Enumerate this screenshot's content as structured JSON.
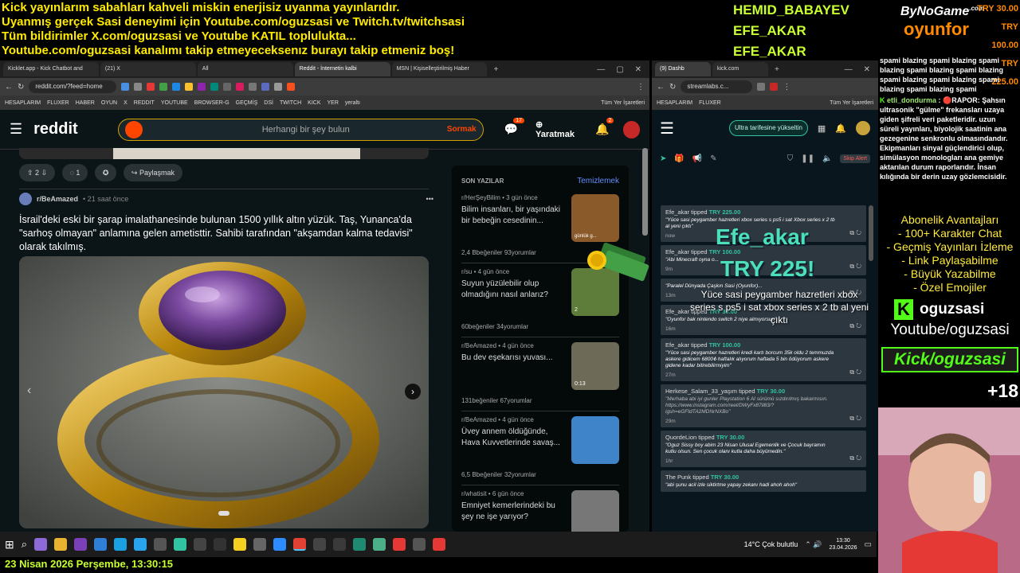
{
  "overlay": {
    "top_lines": [
      "Kick yayınlarım sabahları kahveli miskin enerjisiz uyanma yayınlarıdır.",
      "Uyanmış gerçek Sasi deneyimi için Youtube.com/oguzsasi ve Twitch.tv/twitchsasi",
      "Tüm bildirimler X.com/oguzsasi ve Youtube KATIL toplulukta...",
      "Youtube.com/oguzsasi kanalımı takip etmeyeceksenız burayı takip etmeniz boş!"
    ],
    "top_names": [
      "HEMID_BABAYEV",
      "EFE_AKAR",
      "EFE_AKAR"
    ],
    "sponsor_small": "ByNoGame",
    "sponsor_com": ".com",
    "sponsor_big": "oyunfor",
    "top_donations": [
      "TRY 30.00",
      "TRY 100.00",
      "TRY 225.00"
    ],
    "alert_name": "Efe_akar",
    "alert_amount": "TRY 225!",
    "alert_message": "Yüce sasi peygamber hazretleri xbox series s ps5 i sat xbox series x 2 tb al yeni çıktı",
    "chat": {
      "spam": "spami blazing spami blazing spami blazing spami blazing spami blazing spami blazing spami blazing spami blazing spami blazing spami",
      "user": "etli_dondurma",
      "message": "🔴RAPOR: Şahsın ultrasonik \"gülme\" frekansları uzaya giden şifreli veri paketleridir. uzun süreli yayınları, biyolojik saatinin ana gezegenine senkronlu olmasındandır. Ekipmanları sinyal güçlendirici olup, simülasyon monologları ana gemiye aktarılan durum raporlarıdır. İnsan kılığında bir derin uzay gözlemcisidir."
    },
    "perks": [
      "Abonelik Avantajları",
      "- 100+ Karakter Chat",
      "- Geçmiş Yayınları İzleme",
      "- Link Paylaşabilme",
      "- Büyük Yazabilme",
      "- Özel Emojiler"
    ],
    "kick_handle": "oguzsasi",
    "youtube_handle": "Youtube/oguzsasi",
    "kick_banner": "Kick/oguzsasi",
    "age": "+18",
    "date_line": "23 Nisan 2026 Perşembe, 13:30:15"
  },
  "browser_left": {
    "tabs": [
      "Kicklet.app - Kick Chatbot and",
      "(21) X",
      "All",
      "Reddit - İnternetin kalbi",
      "MSN | Kişiselleştirilmiş Haber"
    ],
    "url": "reddit.com/?feed=home",
    "bookmarks": [
      "HESAPLARIM",
      "FLUXER",
      "HABER",
      "OYUN",
      "X",
      "REDDIT",
      "YOUTUBE",
      "BROWSER-G",
      "GEÇMİŞ",
      "DSİ",
      "TWITCH",
      "KICK",
      "YER",
      "yeraltı",
      "Tüm Yer İşaretleri"
    ]
  },
  "reddit": {
    "logo": "reddit",
    "search_placeholder": "Herhangi bir şey bulun",
    "ask": "Sormak",
    "create": "Yaratmak",
    "chat_badge": "17",
    "notif_badge": "2",
    "prev_votes": "2",
    "prev_comments": "1",
    "share": "Paylaşmak",
    "post_sub": "r/BeAmazed",
    "post_time": "• 21 saat önce",
    "post_title": "İsrail'deki eski bir şarap imalathanesinde bulunan 1500 yıllık altın yüzük. Taş, Yunanca'da \"sarhoş olmayan\" anlamına gelen ametisttir. Sahibi tarafından \"akşamdan kalma tedavisi\" olarak takılmış.",
    "sidebar_title": "SON YAZILAR",
    "sidebar_clear": "Temizlemek",
    "recent": [
      {
        "sub": "r/HerŞeyBilim",
        "time": "• 3 gün önce",
        "title": "Bilim insanları, bir yaşındaki bir bebeğin cesedinin...",
        "stats": "2,4 Bbeğeniler    93yorumlar",
        "thumb_label": "günlük g..."
      },
      {
        "sub": "r/su",
        "time": "• 4 gün önce",
        "title": "Suyun yüzülebilir olup olmadığını nasıl anlarız?",
        "stats": "60beğeniler    34yorumlar",
        "thumb_label": "2"
      },
      {
        "sub": "r/BeAmazed",
        "time": "• 4 gün önce",
        "title": "Bu dev eşekarısı yuvası...",
        "stats": "131beğeniler    67yorumlar",
        "thumb_label": "0:13"
      },
      {
        "sub": "r/BeAmazed",
        "time": "• 4 gün önce",
        "title": "Üvey annem öldüğünde, Hava Kuvvetlerinde savaş...",
        "stats": "6,5 Bbeğeniler    32yorumlar",
        "thumb_label": ""
      },
      {
        "sub": "r/whatisit",
        "time": "• 6 gün önce",
        "title": "Emniyet kemerlerindeki bu şey ne işe yarıyor?",
        "stats": "",
        "thumb_label": ""
      }
    ]
  },
  "browser_right": {
    "tabs": [
      "(9) Dashb",
      "kick.com"
    ],
    "url": "streamlabs.c...",
    "bookmarks": [
      "HESAPLARIM",
      "FLUXER",
      "Tüm Yer İşaretleri"
    ],
    "upgrade": "Ultra tarifesine yükseltin",
    "skip_alert": "Skip Alert",
    "events": [
      {
        "user": "Efe_akar",
        "verb": "tipped",
        "amount": "TRY 225.00",
        "msg": "\"Yüce sasi peygamber hazretleri xbox series s ps5 i sat Xbox series x 2 tb al yeni çıktı\"",
        "time": "now"
      },
      {
        "user": "Efe_akar",
        "verb": "tipped",
        "amount": "TRY 100.00",
        "msg": "\"Abi Minecraft oyna o...",
        "time": "9m"
      },
      {
        "user": "",
        "verb": "",
        "amount": "",
        "msg": "\"Paralel Dünyada Çaşkın Sasi (Oyunfor)...",
        "time": "13m"
      },
      {
        "user": "Efe_akar",
        "verb": "tipped",
        "amount": "TRY 30.00",
        "msg": "\"Oyunfor bak nintendo switch 2 niye almıyorsun\"",
        "time": "16m"
      },
      {
        "user": "Efe_akar",
        "verb": "tipped",
        "amount": "TRY 100.00",
        "msg": "\"Yüce sasi peygamber hazretleri kredi kartı borcum 35k oldu 2 temmuzda askere gidicem 6800₺ haftalık alıyorum haftada 5 bin ödüyorum askere gidene kadar bitirebilirmiyim\"",
        "time": "27m"
      },
      {
        "user": "Herkese_Salam_33_yaşım",
        "verb": "tipped",
        "amount": "TRY 30.00",
        "msg": "\"Merhaba abi iyi gunler Playstation 6 AI sürümü sızdırılmış bakarmısın. https://www.instagram.com/reel/DWyFx87il83/?igsh=eGFtdTA2MDNrNXBo\"",
        "time": "29m"
      },
      {
        "user": "QuordeLion",
        "verb": "tipped",
        "amount": "TRY 30.00",
        "msg": "\"Oguz Sissy boy abim 23 Nisan Ulusal Egemenlik ve Çocuk bayramın kutlu olsun. Sen çocuk olanı kutla daha büyümedin.\"",
        "time": "1hr"
      },
      {
        "user": "The Punk",
        "verb": "tipped",
        "amount": "TRY 30.00",
        "msg": "\"abi şunu acil izle siktirtme yapay zekanı hadi ahoh ahoh\"",
        "time": ""
      }
    ]
  },
  "taskbar": {
    "weather": "14°C  Çok bulutlu",
    "time": "13:30",
    "date": "23.04.2026"
  },
  "colors": {
    "overlay_yellow": "#ffeb00",
    "overlay_green": "#c8ff2e",
    "reddit_orange": "#ff4500",
    "kick_green": "#53fc18",
    "streamlabs_teal": "#31c3a2"
  }
}
